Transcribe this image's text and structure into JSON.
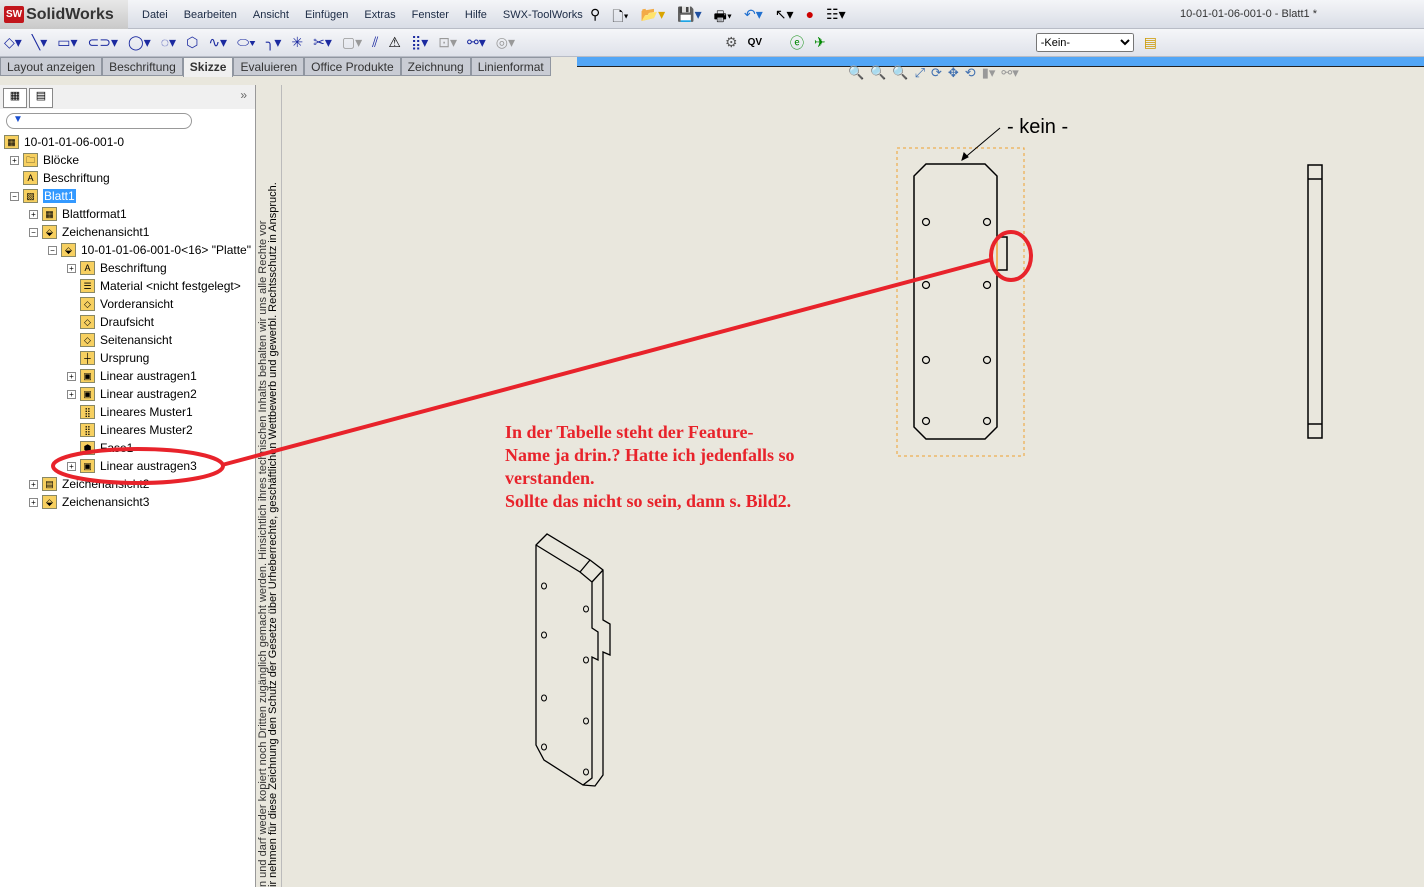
{
  "app": {
    "name": "SolidWorks",
    "logo_badge": "SW",
    "doc_title": "10-01-01-06-001-0 - Blatt1 *"
  },
  "menu": [
    "Datei",
    "Bearbeiten",
    "Ansicht",
    "Einfügen",
    "Extras",
    "Fenster",
    "Hilfe",
    "SWX-ToolWorks"
  ],
  "tabs": [
    "Layout anzeigen",
    "Beschriftung",
    "Skizze",
    "Evaluieren",
    "Office Produkte",
    "Zeichnung",
    "Linienformat"
  ],
  "active_tab": "Skizze",
  "layer_select": {
    "value": "-Kein-"
  },
  "toolbar_labels": {
    "qv": "QV"
  },
  "tree": [
    {
      "label": "10-01-01-06-001-0",
      "level": 0
    },
    {
      "label": "Blöcke",
      "level": 1
    },
    {
      "label": "Beschriftung",
      "level": 1
    },
    {
      "label": "Blatt1",
      "level": 1,
      "selected": true
    },
    {
      "label": "Blattformat1",
      "level": 2
    },
    {
      "label": "Zeichenansicht1",
      "level": 2
    },
    {
      "label": "10-01-01-06-001-0<16> \"Platte\"",
      "level": 3
    },
    {
      "label": "Beschriftung",
      "level": 4
    },
    {
      "label": "Material <nicht festgelegt>",
      "level": 4
    },
    {
      "label": "Vorderansicht",
      "level": 4
    },
    {
      "label": "Draufsicht",
      "level": 4
    },
    {
      "label": "Seitenansicht",
      "level": 4
    },
    {
      "label": "Ursprung",
      "level": 4
    },
    {
      "label": "Linear austragen1",
      "level": 4
    },
    {
      "label": "Linear austragen2",
      "level": 4
    },
    {
      "label": "Lineares Muster1",
      "level": 4
    },
    {
      "label": "Lineares Muster2",
      "level": 4
    },
    {
      "label": "Fase1",
      "level": 4
    },
    {
      "label": "Linear austragen3",
      "level": 4
    },
    {
      "label": "Zeichenansicht2",
      "level": 2
    },
    {
      "label": "Zeichenansicht3",
      "level": 2
    }
  ],
  "sheet_notice": {
    "line1": "n und darf weder kopiert noch Dritten zugänglich gemacht werden. Hinsichtlich ihres technischen Inhalts behalten wir uns alle Rechte vor",
    "line2": "ir nehmen für diese Zeichnung den Schutz der Gesetze über Urheberrechte, geschäftlichen Wettbewerb und gewerbl. Rechtsschutz in Anspruch."
  },
  "drawing": {
    "note_label": "- kein -"
  },
  "annotation": {
    "lines": [
      "In der Tabelle steht der Feature-",
      "Name ja drin.? Hatte ich jedenfalls so",
      "verstanden.",
      "Sollte das nicht so sein, dann s. Bild2."
    ],
    "color": "#e8232b"
  }
}
